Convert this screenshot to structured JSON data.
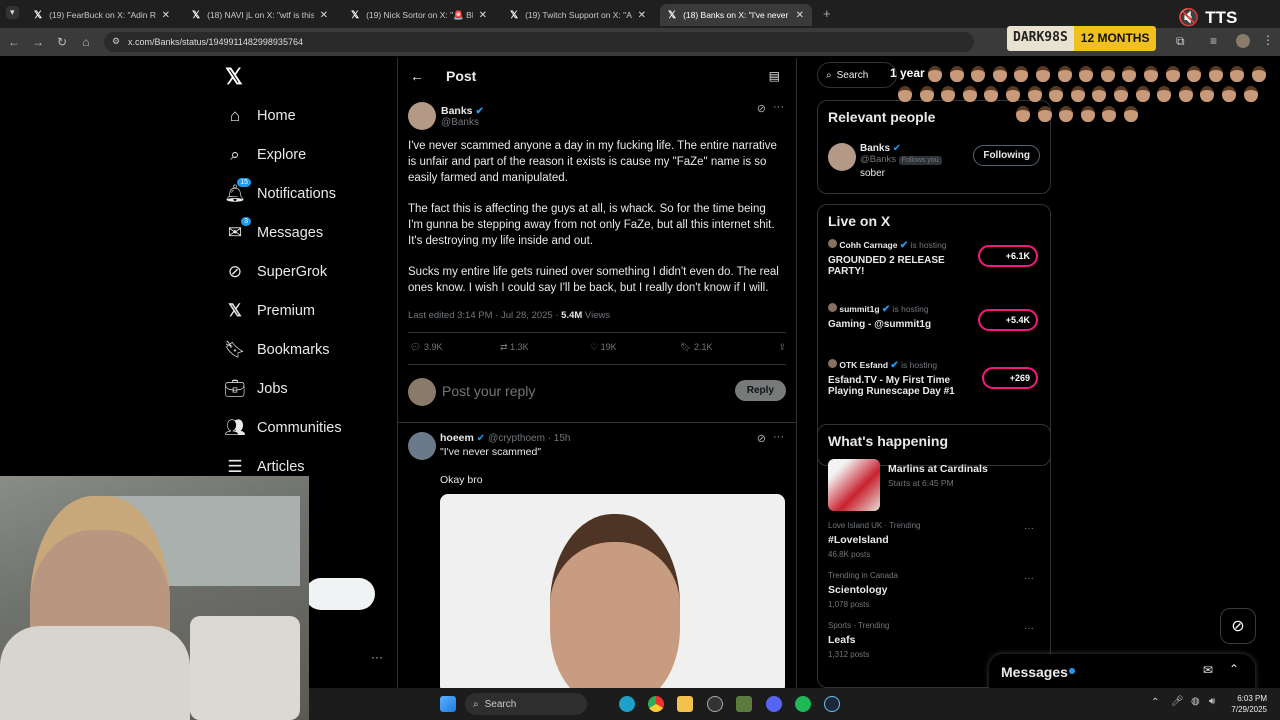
{
  "browser": {
    "tabs": [
      {
        "title": "(19) FearBuck on X: \"Adin Ross",
        "active": false
      },
      {
        "title": "(18) NAVI jL on X: \"wtf is this 😭",
        "active": false
      },
      {
        "title": "(19) Nick Sortor on X: \"🚨 BREA",
        "active": false
      },
      {
        "title": "(19) Twitch Support on X: \"A qu",
        "active": false
      },
      {
        "title": "(18) Banks on X: \"I've never sca",
        "active": true
      }
    ],
    "url": "x.com/Banks/status/1949911482998935764"
  },
  "overlay": {
    "sub_user": "DARK98S",
    "sub_months": "12 MONTHS",
    "tts": "TTS",
    "emote_label": "1 year"
  },
  "sidebar": {
    "items": [
      {
        "label": "Home",
        "icon": "home-icon"
      },
      {
        "label": "Explore",
        "icon": "search-icon"
      },
      {
        "label": "Notifications",
        "icon": "bell-icon",
        "badge": "15"
      },
      {
        "label": "Messages",
        "icon": "mail-icon",
        "badge": "3"
      },
      {
        "label": "SuperGrok",
        "icon": "grok-icon"
      },
      {
        "label": "Premium",
        "icon": "x-logo-icon"
      },
      {
        "label": "Bookmarks",
        "icon": "bookmark-icon"
      },
      {
        "label": "Jobs",
        "icon": "briefcase-icon"
      },
      {
        "label": "Communities",
        "icon": "people-icon"
      },
      {
        "label": "Articles",
        "icon": "article-icon"
      }
    ]
  },
  "post": {
    "header": "Post",
    "author_name": "Banks",
    "author_handle": "@Banks",
    "paragraphs": [
      "I've never scammed anyone a day in my fucking life. The entire narrative is unfair and part of the reason it exists is cause my \"FaZe\" name is so easily farmed and manipulated.",
      "The fact this is affecting the guys at all, is whack. So for the time being I'm gunna be stepping away from not only FaZe, but all this internet shit. It's destroying my life inside and out.",
      "Sucks my entire life gets ruined over something I didn't even do. The real ones know. I wish I could say I'll be back, but I really don't know if I will."
    ],
    "meta": "Last edited 3:14 PM · Jul 28, 2025 · ",
    "views": "5.4M",
    "views_label": "Views",
    "stats": {
      "replies": "3.9K",
      "reposts": "1.3K",
      "likes": "19K",
      "bookmarks": "2.1K"
    },
    "reply_placeholder": "Post your reply",
    "reply_button": "Reply"
  },
  "reply": {
    "name": "hoeem",
    "handle": "@crypthoem · 15h",
    "quote": "\"I've never scammed\"",
    "text": "Okay bro"
  },
  "right": {
    "search": "Search",
    "relevant_title": "Relevant people",
    "relevant": {
      "name": "Banks",
      "handle": "@Banks",
      "follows": "Follows you",
      "bio": "sober",
      "button": "Following"
    },
    "live_title": "Live on X",
    "live": [
      {
        "host": "Cohh Carnage",
        "status": "is hosting",
        "title": "GROUNDED 2 RELEASE PARTY!",
        "count": "+6.1K"
      },
      {
        "host": "summit1g",
        "status": "is hosting",
        "title": "Gaming - @summit1g",
        "count": "+5.4K"
      },
      {
        "host": "OTK Esfand",
        "status": "is hosting",
        "title": "Esfand.TV - My First Time Playing Runescape Day #1",
        "count": "+269"
      }
    ],
    "happening_title": "What's happening",
    "event": {
      "name": "Marlins at Cardinals",
      "time": "Starts at 6:45 PM"
    },
    "trends": [
      {
        "category": "Love Island UK · Trending",
        "name": "#LoveIsland",
        "count": "46.8K posts"
      },
      {
        "category": "Trending in Canada",
        "name": "Scientology",
        "count": "1,078 posts"
      },
      {
        "category": "Sports · Trending",
        "name": "Leafs",
        "count": "1,312 posts"
      }
    ],
    "messages": "Messages"
  },
  "taskbar": {
    "search": "Search",
    "time": "6:03 PM",
    "date": "7/29/2025"
  }
}
